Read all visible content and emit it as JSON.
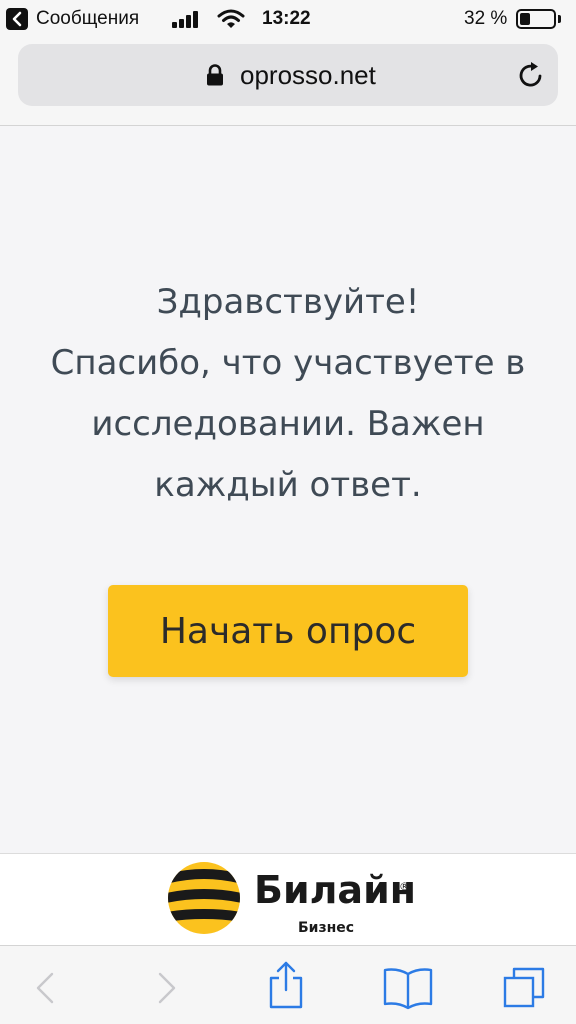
{
  "status_bar": {
    "back_app": "Сообщения",
    "time": "13:22",
    "battery_percent": "32 %",
    "battery_level": 0.32
  },
  "browser": {
    "url": "oprosso.net"
  },
  "page": {
    "greeting_lines": [
      "Здравствуйте!",
      "Спасибо, что участвуете в",
      "исследовании. Важен",
      "каждый ответ."
    ],
    "start_button": "Начать опрос",
    "accent_color": "#fbc21e"
  },
  "footer": {
    "brand_name": "Билайн",
    "brand_sub": "Бизнес"
  },
  "toolbar": {
    "icons": [
      "back-icon",
      "forward-icon",
      "share-icon",
      "bookmarks-icon",
      "tabs-icon"
    ]
  }
}
